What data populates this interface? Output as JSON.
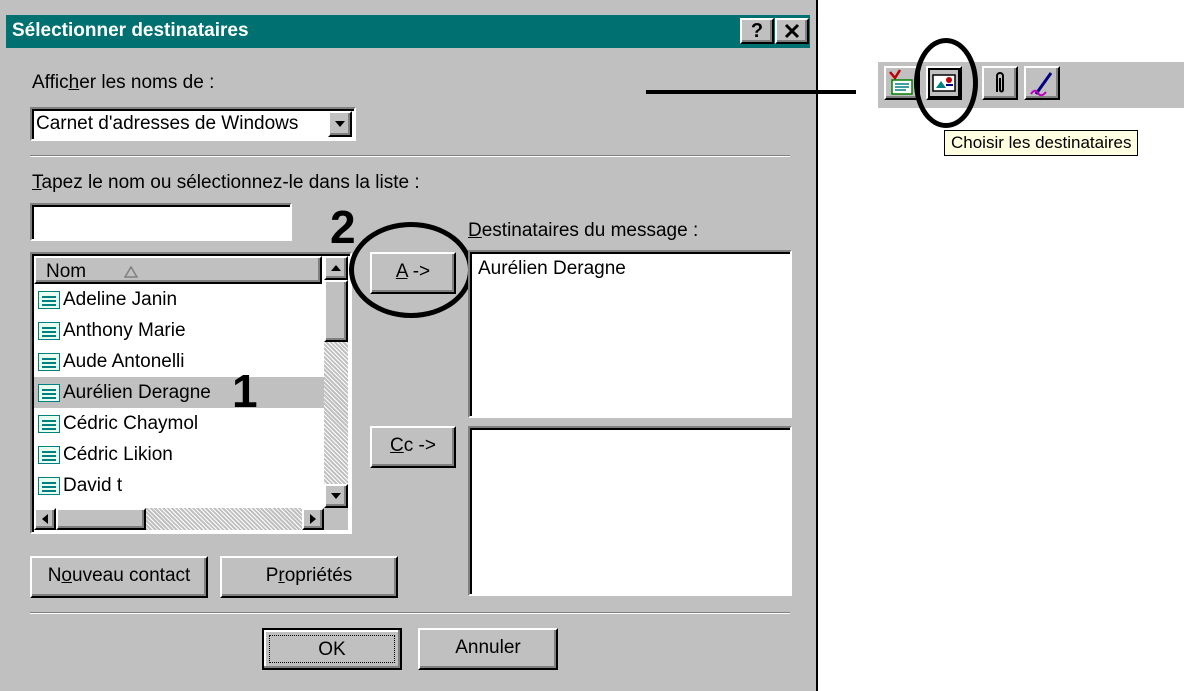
{
  "dialog": {
    "title": "Sélectionner destinataires",
    "help_button": "?",
    "close_button": "✕",
    "show_names_label_pre": "Affic",
    "show_names_label_key": "h",
    "show_names_label_post": "er les noms de :",
    "address_book_selected": "Carnet d'adresses de Windows",
    "type_label_key": "T",
    "type_label_post": "apez le nom ou sélectionnez-le dans la liste :",
    "search_value": "",
    "list_header_name": "Nom",
    "contacts": [
      "Adeline Janin",
      "Anthony Marie",
      "Aude Antonelli",
      "Aurélien Deragne",
      "Cédric Chaymol",
      "Cédric Likion",
      "David t"
    ],
    "selected_contact": "Aurélien Deragne",
    "to_button_key": "A",
    "to_button_post": " ->",
    "cc_button_key": "C",
    "cc_button_post": "c ->",
    "recipients_label_key": "D",
    "recipients_label_post": "estinataires du message :",
    "to_recipients": [
      "Aurélien Deragne"
    ],
    "cc_recipients": [],
    "new_contact_pre": "N",
    "new_contact_key": "o",
    "new_contact_post": "uveau contact",
    "properties_pre": "P",
    "properties_key": "r",
    "properties_post": "opriétés",
    "ok_label": "OK",
    "cancel_label": "Annuler"
  },
  "annotations": {
    "step_1": "1",
    "step_2": "2"
  },
  "toolbar": {
    "tooltip": "Choisir les destinataires",
    "icons": [
      "check-names-icon",
      "address-book-icon",
      "paperclip-icon",
      "signature-pen-icon"
    ]
  }
}
